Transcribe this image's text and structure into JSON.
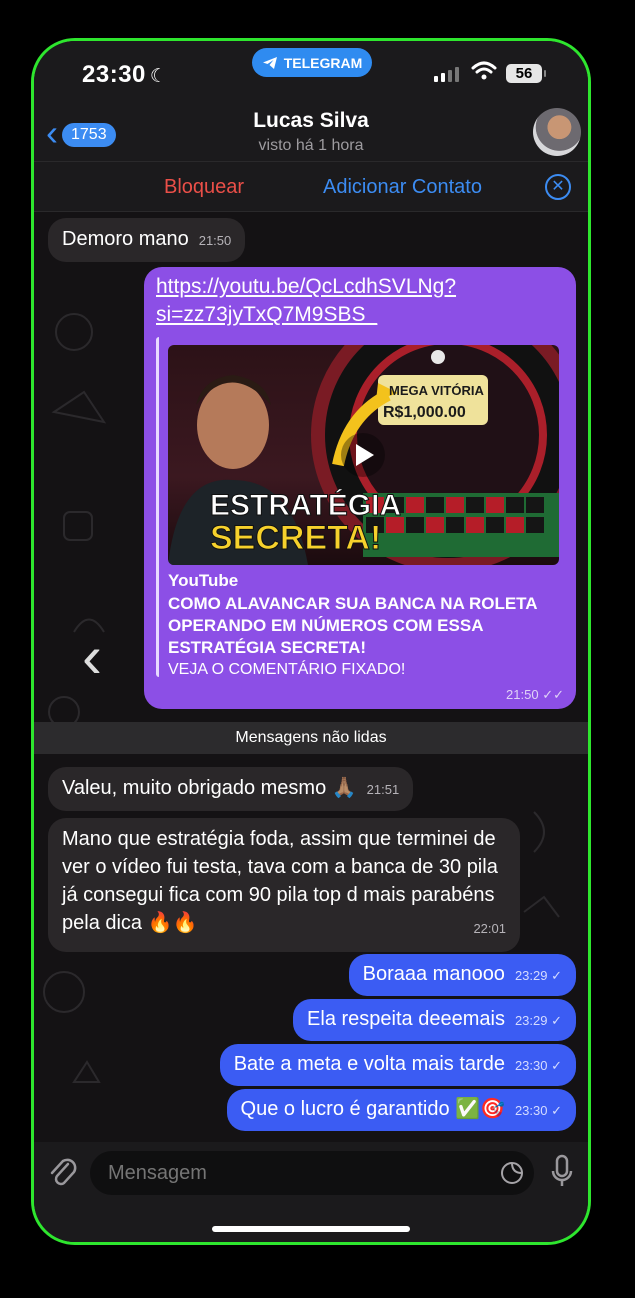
{
  "status_bar": {
    "time": "23:30",
    "pill": "TELEGRAM",
    "battery": "56"
  },
  "header": {
    "back_count": "1753",
    "name": "Lucas Silva",
    "last_seen": "visto há 1 hora"
  },
  "actions": {
    "block": "Bloquear",
    "add_contact": "Adicionar Contato"
  },
  "messages": {
    "m1": {
      "text": "Demoro mano",
      "time": "21:50"
    },
    "link": {
      "url": "https://youtu.be/QcLcdhSVLNg?si=zz73jyTxQ7M9SBS_",
      "site": "YouTube",
      "title": "COMO ALAVANCAR SUA BANCA NA ROLETA OPERANDO EM NÚMEROS COM ESSA ESTRATÉGIA SECRETA!",
      "desc": "VEJA O COMENTÁRIO FIXADO!",
      "thumb_badge": "MEGA VITÓRIA",
      "thumb_amount": "R$1,000.00",
      "thumb_title_1": "ESTRATÉGIA",
      "thumb_title_2": "SECRETA!",
      "time": "21:50"
    },
    "unread_divider": "Mensagens não lidas",
    "m2": {
      "text": "Valeu, muito obrigado mesmo 🙏🏽",
      "time": "21:51"
    },
    "m3": {
      "text": "Mano que estratégia foda, assim que terminei de ver o vídeo fui testa, tava com a banca de 30 pila já consegui fica com 90 pila top d mais parabéns pela dica 🔥🔥",
      "time": "22:01"
    },
    "o1": {
      "text": "Boraaa manooo",
      "time": "23:29"
    },
    "o2": {
      "text": "Ela respeita deeemais",
      "time": "23:29"
    },
    "o3": {
      "text": "Bate a meta e volta mais tarde",
      "time": "23:30"
    },
    "o4": {
      "text": "Que o lucro é garantido ✅🎯",
      "time": "23:30"
    }
  },
  "input": {
    "placeholder": "Mensagem"
  },
  "colors": {
    "accent": "#3c8cf2",
    "outgoing": "#3b5cf3",
    "link_bubble": "#8c4fe6",
    "frame": "#2ee62e",
    "danger": "#ea4f48"
  }
}
